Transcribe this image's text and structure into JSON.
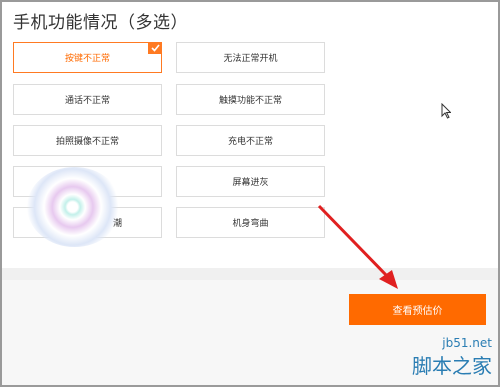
{
  "section": {
    "title": "手机功能情况（多选）"
  },
  "options": [
    {
      "label": "按键不正常",
      "selected": true
    },
    {
      "label": "无法正常开机",
      "selected": false
    },
    {
      "label": "通话不正常",
      "selected": false
    },
    {
      "label": "触摸功能不正常",
      "selected": false
    },
    {
      "label": "拍照摄像不正常",
      "selected": false
    },
    {
      "label": "充电不正常",
      "selected": false
    },
    {
      "label": "",
      "selected": false
    },
    {
      "label": "屏幕进灰",
      "selected": false
    },
    {
      "label": "潮",
      "selected": false
    },
    {
      "label": "机身弯曲",
      "selected": false
    }
  ],
  "cta": {
    "label": "查看预估价"
  },
  "watermark": {
    "url": "jb51.net",
    "name": "脚本之家"
  },
  "colors": {
    "accent": "#ff6a00",
    "annotation_arrow": "#e02020",
    "watermark": "#2a7db3"
  },
  "icons": {
    "check": "checkmark-icon",
    "cursor": "mouse-pointer-icon"
  }
}
